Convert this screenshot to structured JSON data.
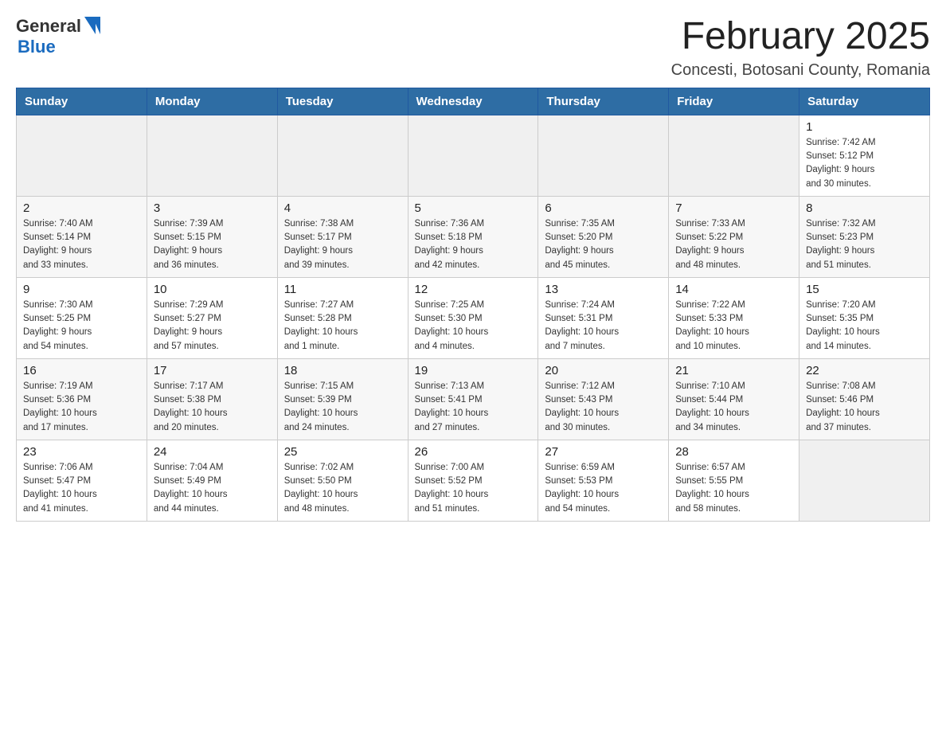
{
  "header": {
    "logo_general": "General",
    "logo_blue": "Blue",
    "month_year": "February 2025",
    "location": "Concesti, Botosani County, Romania"
  },
  "weekdays": [
    "Sunday",
    "Monday",
    "Tuesday",
    "Wednesday",
    "Thursday",
    "Friday",
    "Saturday"
  ],
  "weeks": [
    [
      {
        "day": "",
        "info": ""
      },
      {
        "day": "",
        "info": ""
      },
      {
        "day": "",
        "info": ""
      },
      {
        "day": "",
        "info": ""
      },
      {
        "day": "",
        "info": ""
      },
      {
        "day": "",
        "info": ""
      },
      {
        "day": "1",
        "info": "Sunrise: 7:42 AM\nSunset: 5:12 PM\nDaylight: 9 hours\nand 30 minutes."
      }
    ],
    [
      {
        "day": "2",
        "info": "Sunrise: 7:40 AM\nSunset: 5:14 PM\nDaylight: 9 hours\nand 33 minutes."
      },
      {
        "day": "3",
        "info": "Sunrise: 7:39 AM\nSunset: 5:15 PM\nDaylight: 9 hours\nand 36 minutes."
      },
      {
        "day": "4",
        "info": "Sunrise: 7:38 AM\nSunset: 5:17 PM\nDaylight: 9 hours\nand 39 minutes."
      },
      {
        "day": "5",
        "info": "Sunrise: 7:36 AM\nSunset: 5:18 PM\nDaylight: 9 hours\nand 42 minutes."
      },
      {
        "day": "6",
        "info": "Sunrise: 7:35 AM\nSunset: 5:20 PM\nDaylight: 9 hours\nand 45 minutes."
      },
      {
        "day": "7",
        "info": "Sunrise: 7:33 AM\nSunset: 5:22 PM\nDaylight: 9 hours\nand 48 minutes."
      },
      {
        "day": "8",
        "info": "Sunrise: 7:32 AM\nSunset: 5:23 PM\nDaylight: 9 hours\nand 51 minutes."
      }
    ],
    [
      {
        "day": "9",
        "info": "Sunrise: 7:30 AM\nSunset: 5:25 PM\nDaylight: 9 hours\nand 54 minutes."
      },
      {
        "day": "10",
        "info": "Sunrise: 7:29 AM\nSunset: 5:27 PM\nDaylight: 9 hours\nand 57 minutes."
      },
      {
        "day": "11",
        "info": "Sunrise: 7:27 AM\nSunset: 5:28 PM\nDaylight: 10 hours\nand 1 minute."
      },
      {
        "day": "12",
        "info": "Sunrise: 7:25 AM\nSunset: 5:30 PM\nDaylight: 10 hours\nand 4 minutes."
      },
      {
        "day": "13",
        "info": "Sunrise: 7:24 AM\nSunset: 5:31 PM\nDaylight: 10 hours\nand 7 minutes."
      },
      {
        "day": "14",
        "info": "Sunrise: 7:22 AM\nSunset: 5:33 PM\nDaylight: 10 hours\nand 10 minutes."
      },
      {
        "day": "15",
        "info": "Sunrise: 7:20 AM\nSunset: 5:35 PM\nDaylight: 10 hours\nand 14 minutes."
      }
    ],
    [
      {
        "day": "16",
        "info": "Sunrise: 7:19 AM\nSunset: 5:36 PM\nDaylight: 10 hours\nand 17 minutes."
      },
      {
        "day": "17",
        "info": "Sunrise: 7:17 AM\nSunset: 5:38 PM\nDaylight: 10 hours\nand 20 minutes."
      },
      {
        "day": "18",
        "info": "Sunrise: 7:15 AM\nSunset: 5:39 PM\nDaylight: 10 hours\nand 24 minutes."
      },
      {
        "day": "19",
        "info": "Sunrise: 7:13 AM\nSunset: 5:41 PM\nDaylight: 10 hours\nand 27 minutes."
      },
      {
        "day": "20",
        "info": "Sunrise: 7:12 AM\nSunset: 5:43 PM\nDaylight: 10 hours\nand 30 minutes."
      },
      {
        "day": "21",
        "info": "Sunrise: 7:10 AM\nSunset: 5:44 PM\nDaylight: 10 hours\nand 34 minutes."
      },
      {
        "day": "22",
        "info": "Sunrise: 7:08 AM\nSunset: 5:46 PM\nDaylight: 10 hours\nand 37 minutes."
      }
    ],
    [
      {
        "day": "23",
        "info": "Sunrise: 7:06 AM\nSunset: 5:47 PM\nDaylight: 10 hours\nand 41 minutes."
      },
      {
        "day": "24",
        "info": "Sunrise: 7:04 AM\nSunset: 5:49 PM\nDaylight: 10 hours\nand 44 minutes."
      },
      {
        "day": "25",
        "info": "Sunrise: 7:02 AM\nSunset: 5:50 PM\nDaylight: 10 hours\nand 48 minutes."
      },
      {
        "day": "26",
        "info": "Sunrise: 7:00 AM\nSunset: 5:52 PM\nDaylight: 10 hours\nand 51 minutes."
      },
      {
        "day": "27",
        "info": "Sunrise: 6:59 AM\nSunset: 5:53 PM\nDaylight: 10 hours\nand 54 minutes."
      },
      {
        "day": "28",
        "info": "Sunrise: 6:57 AM\nSunset: 5:55 PM\nDaylight: 10 hours\nand 58 minutes."
      },
      {
        "day": "",
        "info": ""
      }
    ]
  ]
}
